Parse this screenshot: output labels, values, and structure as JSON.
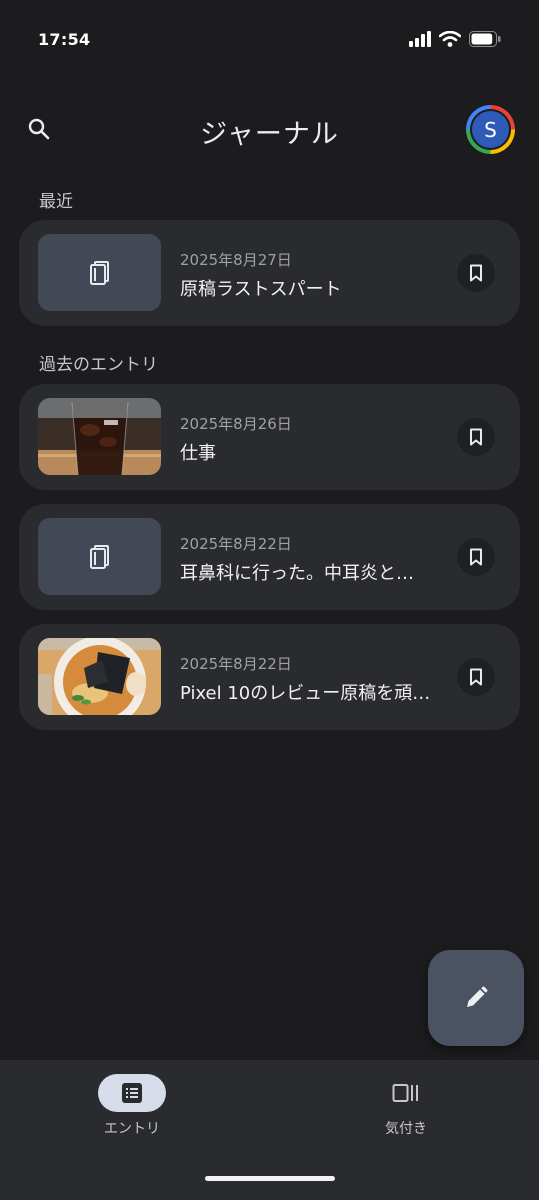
{
  "status_bar": {
    "time": "17:54",
    "battery_level": 0.9
  },
  "header": {
    "title": "ジャーナル",
    "avatar_initial": "S"
  },
  "sections": {
    "recent": "最近",
    "past": "過去のエントリ"
  },
  "recent_entries": [
    {
      "date": "2025年8月27日",
      "title": "原稿ラストスパート",
      "thumbnail": "journal-placeholder-icon"
    }
  ],
  "past_entries": [
    {
      "date": "2025年8月26日",
      "title": "仕事",
      "thumbnail": "iced-coffee-photo"
    },
    {
      "date": "2025年8月22日",
      "title": "耳鼻科に行った。中耳炎と…",
      "thumbnail": "journal-placeholder-icon"
    },
    {
      "date": "2025年8月22日",
      "title": "Pixel 10のレビュー原稿を頑…",
      "thumbnail": "ramen-photo"
    }
  ],
  "bottom_nav": {
    "items": [
      {
        "label": "エントリ",
        "icon": "entries-list-icon",
        "active": true
      },
      {
        "label": "気付き",
        "icon": "insights-icon",
        "active": false
      }
    ]
  },
  "colors": {
    "background": "#1c1c1e",
    "card": "#2a2b2f",
    "fab": "#4b5262",
    "nav_active": "#d7dcea"
  }
}
